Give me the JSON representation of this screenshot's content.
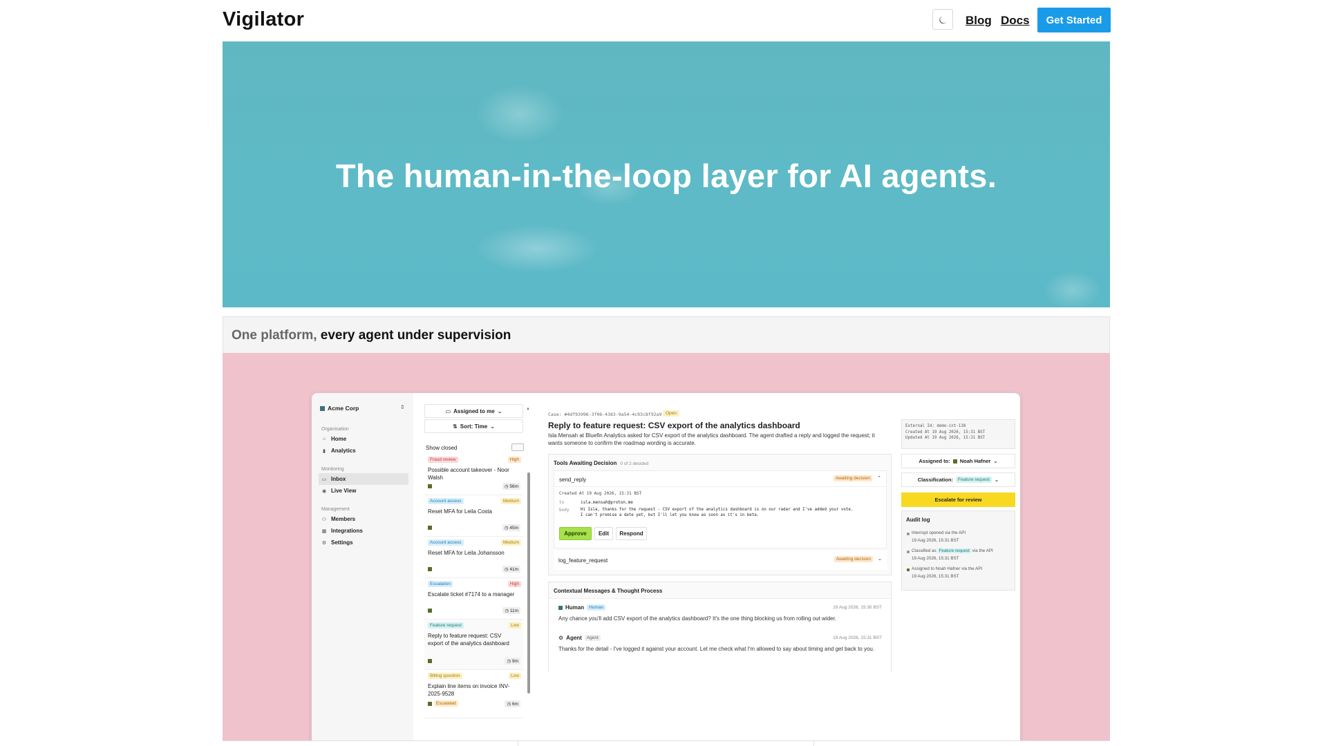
{
  "nav": {
    "brand": "Vigilator",
    "theme_icon": "moon-icon",
    "links": [
      "Blog",
      "Docs"
    ],
    "cta": "Get Started",
    "cta_color": "#1a9be8"
  },
  "hero": {
    "title": "The human-in-the-loop layer for AI agents."
  },
  "section": {
    "title_a": "One platform,",
    "title_b": "every agent under supervision"
  },
  "app": {
    "org": "Acme Corp",
    "sidebar": {
      "groups": [
        "Organisation",
        "Monitoring",
        "Management"
      ],
      "items": [
        {
          "label": "Home",
          "icon": "home-icon"
        },
        {
          "label": "Analytics",
          "icon": "bar-chart-icon"
        },
        {
          "label": "Inbox",
          "icon": "inbox-icon"
        },
        {
          "label": "Live View",
          "icon": "eye-icon"
        },
        {
          "label": "Members",
          "icon": "users-icon"
        },
        {
          "label": "Integrations",
          "icon": "plug-icon"
        },
        {
          "label": "Settings",
          "icon": "gear-icon"
        }
      ]
    },
    "list": {
      "filter": "Assigned to me",
      "sort": "Sort: Time",
      "show_closed": "Show closed",
      "cards": [
        {
          "category": "Fraud review",
          "priority": "High",
          "title": "Possible account takeover - Noor Walsh",
          "age": "56m"
        },
        {
          "category": "Account access",
          "priority": "Medium",
          "title": "Reset MFA for Leila Costa",
          "age": "45m"
        },
        {
          "category": "Account access",
          "priority": "Medium",
          "title": "Reset MFA for Leila Johansson",
          "age": "41m"
        },
        {
          "category": "Escalation",
          "priority": "High",
          "title": "Escalate ticket #7174 to a manager",
          "age": "11m"
        },
        {
          "category": "Feature request",
          "priority": "Low",
          "title": "Reply to feature request: CSV export of the analytics dashboard",
          "age": "9m"
        },
        {
          "category": "Billing question",
          "priority": "Low",
          "title": "Explain line items on invoice INV-2025-9528",
          "age": "6m",
          "status": "Escalated"
        }
      ]
    },
    "case": {
      "id": "Case: #4df93996-3f06-4383-9a54-4c93c8f92a9",
      "status": "Open",
      "title": "Reply to feature request: CSV export of the analytics dashboard",
      "description": "Isla Mensah at Bluefin Analytics asked for CSV export of the analytics dashboard. The agent drafted a reply and logged the request; it wants someone to confirm the roadmap wording is accurate.",
      "tools_title": "Tools Awaiting Decision",
      "tools_count": "0 of 2 decided",
      "tools": [
        {
          "name": "send_reply",
          "status": "Awaiting decision"
        },
        {
          "name": "log_feature_request",
          "status": "Awaiting decision"
        }
      ],
      "tool_detail": {
        "created": "Created At 19 Aug 2026, 15:31 BST",
        "to_label": "to",
        "to_value": "isla.mensah@proton.me",
        "body_label": "body",
        "body_line1": "Hi Isla, thanks for the request - CSV export of the analytics dashboard is on our radar and I've added your vote.",
        "body_line2": "I can't promise a date yet, but I'll let you know as soon as it's in beta."
      },
      "actions": [
        "Approve",
        "Edit",
        "Respond"
      ],
      "messages_title": "Contextual Messages & Thought Process",
      "messages": [
        {
          "who": "Human",
          "tag": "Human",
          "time": "19 Aug 2026, 15:30 BST",
          "text": "Any chance you'll add CSV export of the analytics dashboard? It's the one thing blocking us from rolling out wider."
        },
        {
          "who": "Agent",
          "tag": "Agent",
          "time": "19 Aug 2026, 15:31 BST",
          "text": "Thanks for the detail - I've logged it against your account. Let me check what I'm allowed to say about timing and get back to you."
        }
      ]
    },
    "right": {
      "meta": [
        "External Id: demo-int-138",
        "Created At 19 Aug 2026, 15:31 BST",
        "Updated At 19 Aug 2026, 15:31 BST"
      ],
      "assigned_label": "Assigned to:",
      "assigned_value": "Noah Hafner",
      "class_label": "Classification:",
      "class_value": "Feature request",
      "escalate": "Escalate for review",
      "escalate_color": "#f8d821",
      "audit_title": "Audit log",
      "audit": [
        {
          "text": "Interrupt opened via the API",
          "time": "19 Aug 2026, 15:31 BST"
        },
        {
          "text_a": "Classified as",
          "badge": "Feature request",
          "text_b": "via the API",
          "time": "19 Aug 2026, 15:31 BST"
        },
        {
          "text": "Assigned to Noah Hafner via the API",
          "time": "19 Aug 2026, 15:31 BST"
        }
      ]
    }
  }
}
